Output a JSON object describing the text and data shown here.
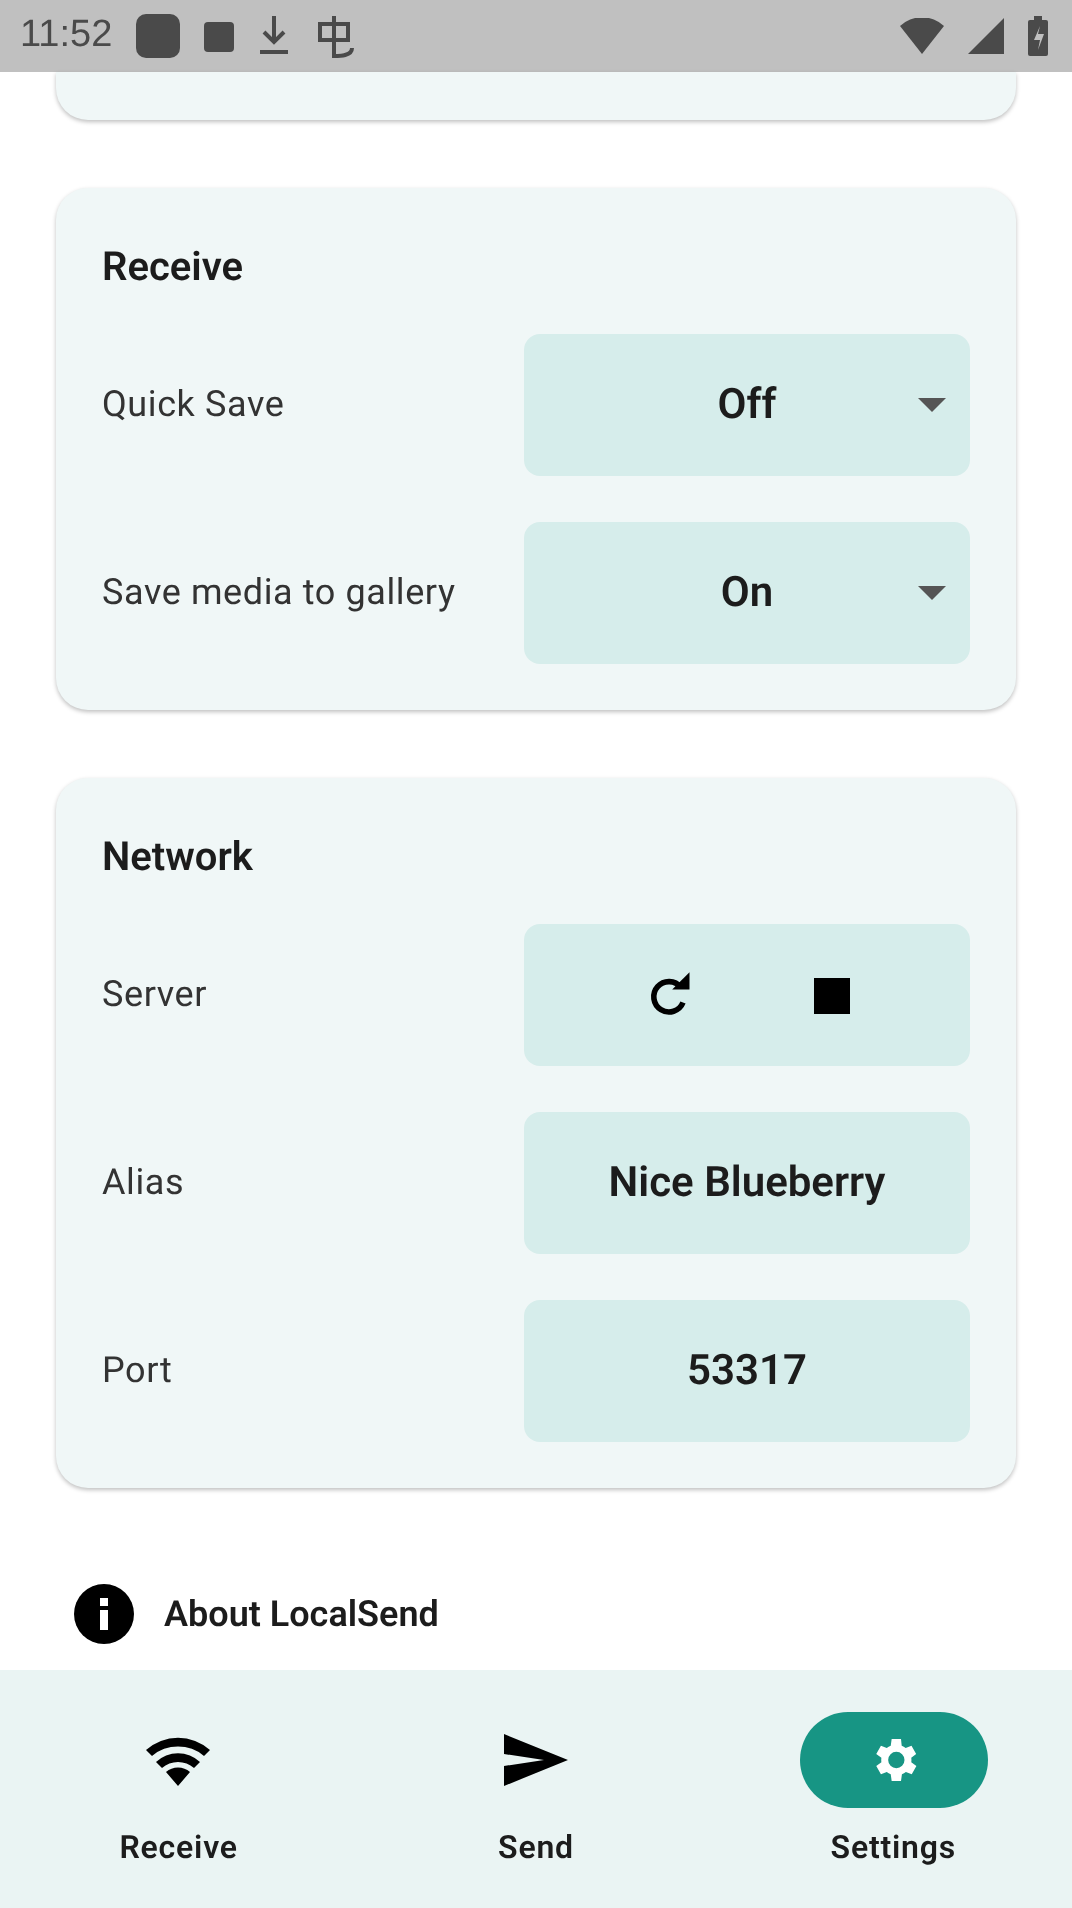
{
  "status_bar": {
    "time": "11:52"
  },
  "sections": [
    {
      "title": "Receive",
      "rows": [
        {
          "label": "Quick Save",
          "kind": "dropdown",
          "value": "Off"
        },
        {
          "label": "Save media to gallery",
          "kind": "dropdown",
          "value": "On"
        }
      ]
    },
    {
      "title": "Network",
      "rows": [
        {
          "label": "Server",
          "kind": "server"
        },
        {
          "label": "Alias",
          "kind": "text",
          "value": "Nice Blueberry"
        },
        {
          "label": "Port",
          "kind": "text",
          "value": "53317"
        }
      ]
    }
  ],
  "about": {
    "label": "About LocalSend"
  },
  "nav": [
    {
      "label": "Receive",
      "kind": "wifi",
      "selected": false
    },
    {
      "label": "Send",
      "kind": "send",
      "selected": false
    },
    {
      "label": "Settings",
      "kind": "gear",
      "selected": true
    }
  ]
}
